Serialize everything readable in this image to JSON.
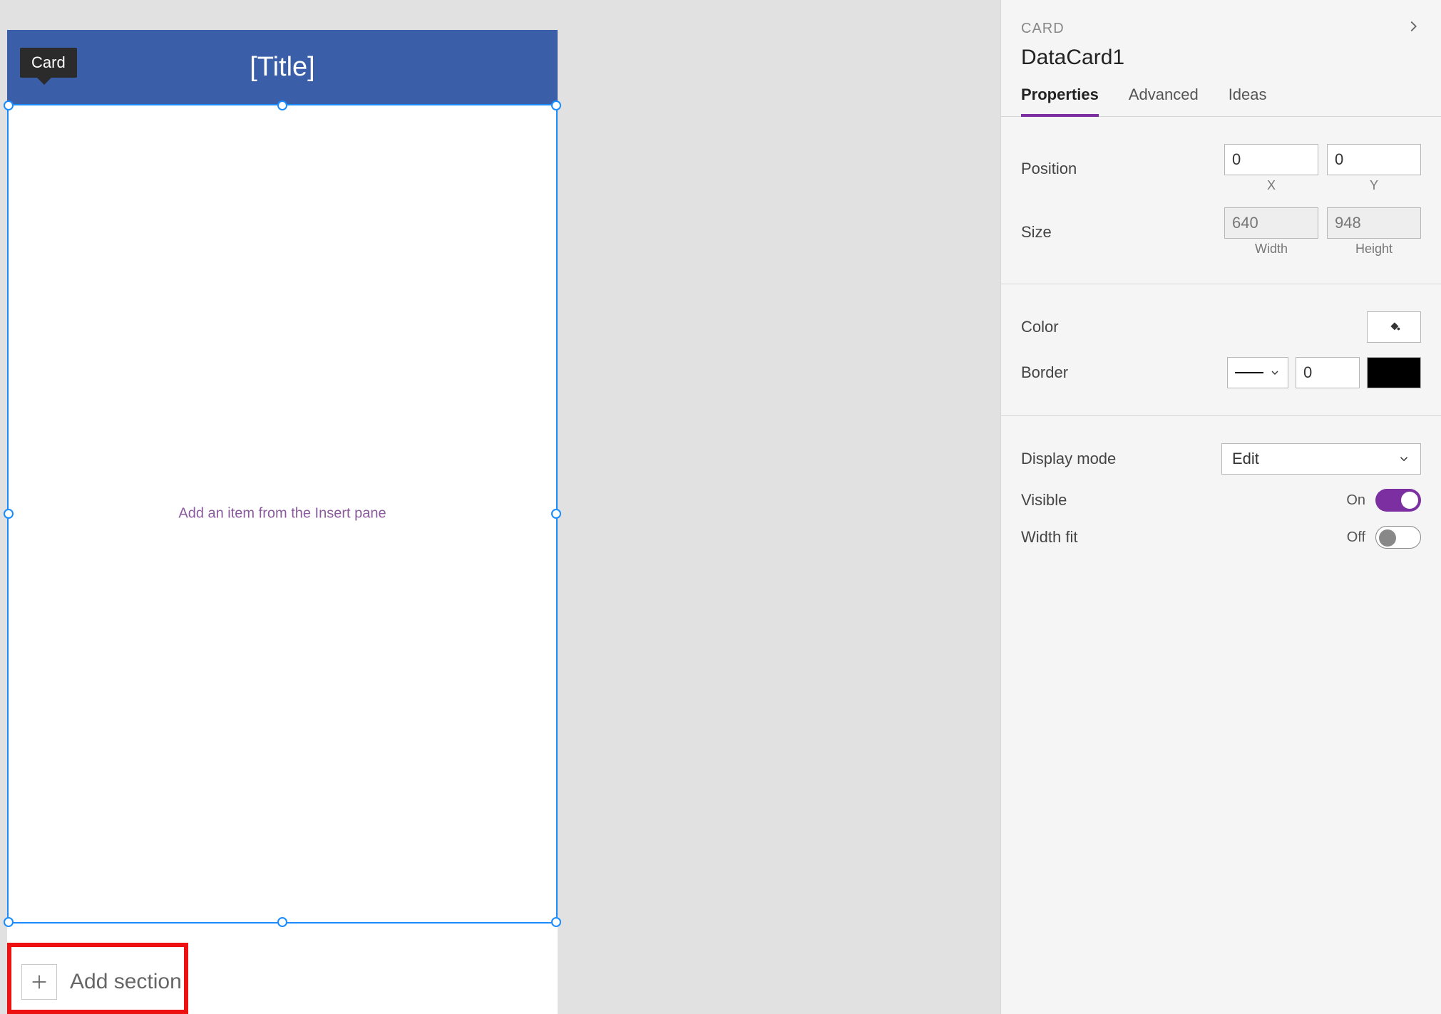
{
  "canvas": {
    "tooltip": "Card",
    "header_title": "[Title]",
    "placeholder": "Add an item from the Insert pane",
    "add_section_label": "Add section"
  },
  "panel": {
    "type_label": "CARD",
    "name": "DataCard1",
    "tabs": {
      "properties": "Properties",
      "advanced": "Advanced",
      "ideas": "Ideas"
    },
    "position": {
      "label": "Position",
      "x": "0",
      "y": "0",
      "x_label": "X",
      "y_label": "Y"
    },
    "size": {
      "label": "Size",
      "width": "640",
      "height": "948",
      "width_label": "Width",
      "height_label": "Height"
    },
    "color": {
      "label": "Color"
    },
    "border": {
      "label": "Border",
      "width": "0",
      "color": "#000000"
    },
    "display_mode": {
      "label": "Display mode",
      "value": "Edit"
    },
    "visible": {
      "label": "Visible",
      "state_label": "On",
      "value": true
    },
    "width_fit": {
      "label": "Width fit",
      "state_label": "Off",
      "value": false
    }
  }
}
